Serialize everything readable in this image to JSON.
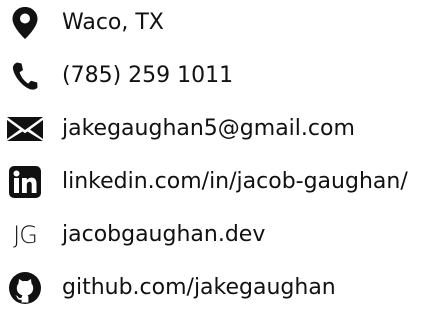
{
  "contacts": [
    {
      "icon": "location-pin-icon",
      "text": "Waco, TX"
    },
    {
      "icon": "phone-icon",
      "text": "(785) 259 1011"
    },
    {
      "icon": "email-icon",
      "text": "jakegaughan5@gmail.com"
    },
    {
      "icon": "linkedin-icon",
      "text": "linkedin.com/in/jacob-gaughan/"
    },
    {
      "icon": "jg-logo-icon",
      "logo_text": "JG",
      "text": "jacobgaughan.dev"
    },
    {
      "icon": "github-icon",
      "text": "github.com/jakegaughan"
    }
  ],
  "colors": {
    "text": "#111111",
    "icon": "#111111",
    "background": "#ffffff"
  }
}
